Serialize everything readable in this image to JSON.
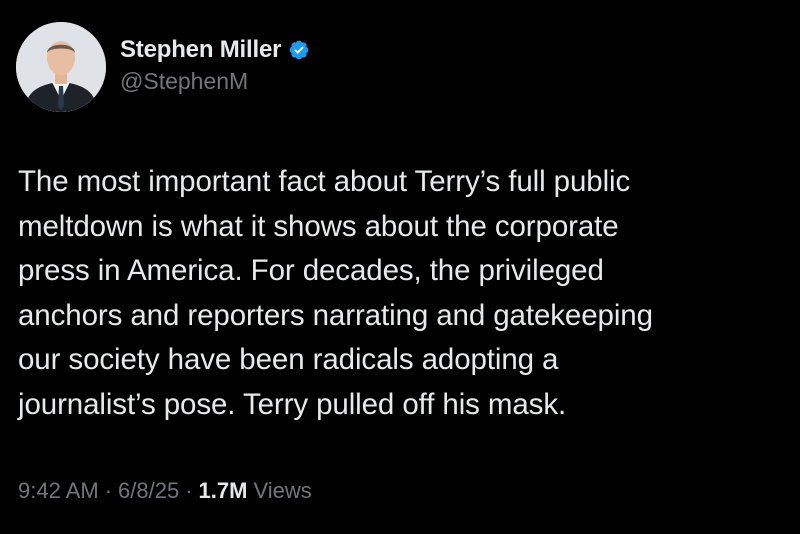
{
  "author": {
    "name": "Stephen Miller",
    "handle": "@StephenM",
    "verified_badge_color": "#1d9bf0",
    "avatar_icon": "profile-photo"
  },
  "tweet": {
    "text": "The most important fact about Terry’s full public\nmeltdown is what it shows about the corporate\npress in America. For decades, the privileged\nanchors and reporters narrating and gatekeeping\nour society have been radicals adopting a\njournalist’s pose. Terry pulled off his mask."
  },
  "meta": {
    "time": "9:42 AM",
    "separator": "·",
    "date": "6/8/25",
    "views_count": "1.7M",
    "views_label": "Views"
  },
  "colors": {
    "background": "#000000",
    "primary_text": "#e7e9ea",
    "secondary_text": "#71767b"
  }
}
